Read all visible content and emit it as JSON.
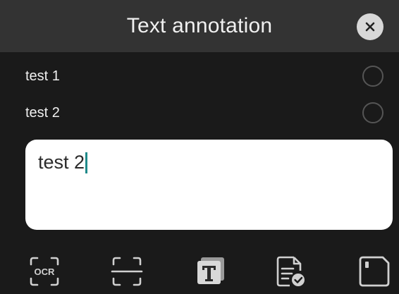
{
  "header": {
    "title": "Text annotation"
  },
  "items": [
    {
      "label": "test 1"
    },
    {
      "label": "test 2"
    }
  ],
  "input": {
    "value": "test 2"
  },
  "toolbar": {
    "ocr_text": "OCR"
  },
  "colors": {
    "background": "#1a1a1a",
    "header": "#333333",
    "caret": "#1f8a8a",
    "icon": "#d0d0d0"
  },
  "icons": [
    "close-icon",
    "ocr-icon",
    "scan-icon",
    "text-format-icon",
    "document-check-icon",
    "save-icon"
  ]
}
